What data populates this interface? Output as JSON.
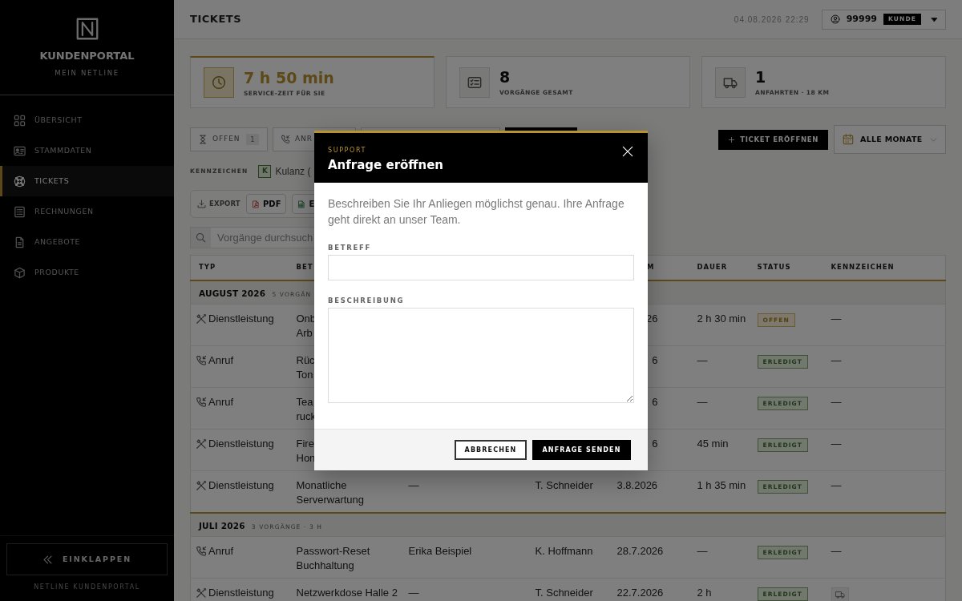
{
  "sidebar": {
    "title": "KUNDENPORTAL",
    "subtitle": "MEIN NETLINE",
    "items": [
      {
        "label": "ÜBERSICHT",
        "selected": false
      },
      {
        "label": "STAMMDATEN",
        "selected": false
      },
      {
        "label": "TICKETS",
        "selected": true
      },
      {
        "label": "RECHNUNGEN",
        "selected": false
      },
      {
        "label": "ANGEBOTE",
        "selected": false
      },
      {
        "label": "PRODUKTE",
        "selected": false
      }
    ],
    "collapse_button": "EINKLAPPEN",
    "footer": "NETLINE KUNDENPORTAL"
  },
  "header": {
    "title": "TICKETS",
    "timestamp": "04.08.2026 22:29",
    "account": {
      "number": "99999",
      "role": "KUNDE"
    }
  },
  "stats": [
    {
      "value": "7 h 50 min",
      "label": "SERVICE-ZEIT FÜR SIE",
      "highlighted": true
    },
    {
      "value": "8",
      "label": "VORGÄNGE GESAMT",
      "highlighted": false
    },
    {
      "value": "1",
      "label": "ANFAHRTEN · 18 KM",
      "highlighted": false
    }
  ],
  "filter_tabs": [
    {
      "label": "OFFEN",
      "count": "1",
      "selected": false
    },
    {
      "label": "ANR",
      "selected": false
    },
    {
      "selected": false
    },
    {
      "selected": true
    }
  ],
  "new_ticket_button": "TICKET ERÖFFNEN",
  "month_filter": "ALLE MONATE",
  "tags": {
    "label": "KENNZEICHEN",
    "items": [
      {
        "letter": "K",
        "text": "Kulanz ("
      }
    ]
  },
  "export": {
    "label": "EXPORT",
    "buttons": [
      "PDF",
      "E"
    ]
  },
  "search": {
    "placeholder": "Vorgänge durchsuch"
  },
  "table": {
    "columns": [
      {
        "label": "TYP"
      },
      {
        "label": "BET"
      },
      {},
      {},
      {
        "label": "M",
        "cut": true
      },
      {
        "label": "DAUER"
      },
      {
        "label": "STATUS"
      },
      {
        "label": "KENNZEICHEN"
      }
    ],
    "groups": [
      {
        "title": "AUGUST 2026",
        "summary": "5 VORGÄN",
        "rows": [
          {
            "kind": "service",
            "type": "Dienstleistung",
            "subject": [
              "Onb",
              "Arb"
            ],
            "date": "26",
            "date_cut": true,
            "duration": "2 h 30 min",
            "status": {
              "kind": "open",
              "text": "OFFEN"
            },
            "mark": {
              "kind": "text",
              "text": "—"
            }
          },
          {
            "kind": "call",
            "type": "Anruf",
            "subject": [
              "Rüc",
              "Ton"
            ],
            "date": "6",
            "date_cut": true,
            "duration": "—",
            "status": {
              "kind": "done",
              "text": "ERLEDIGT"
            },
            "mark": {
              "kind": "text",
              "text": "—"
            }
          },
          {
            "kind": "call",
            "type": "Anruf",
            "subject": [
              "Tea",
              "ruck"
            ],
            "date": "6",
            "date_cut": true,
            "duration": "—",
            "status": {
              "kind": "done",
              "text": "ERLEDIGT"
            },
            "mark": {
              "kind": "text",
              "text": "—"
            }
          },
          {
            "kind": "service",
            "type": "Dienstleistung",
            "subject": [
              "Fire",
              "Hon"
            ],
            "date": "6",
            "date_cut": true,
            "duration": "45 min",
            "status": {
              "kind": "done",
              "text": "ERLEDIGT"
            },
            "mark": {
              "kind": "text",
              "text": "—"
            }
          },
          {
            "kind": "service",
            "type": "Dienstleistung",
            "subject": [
              "Monatliche",
              "Serverwartung"
            ],
            "contact": "—",
            "technician": "T. Schneider",
            "date": "3.8.2026",
            "duration": "1 h 35 min",
            "status": {
              "kind": "done",
              "text": "ERLEDIGT"
            },
            "mark": {
              "kind": "text",
              "text": "—"
            }
          }
        ]
      },
      {
        "title": "JULI 2026",
        "summary": "3 VORGÄNGE · 3 H",
        "rows": [
          {
            "kind": "call",
            "type": "Anruf",
            "subject": [
              "Passwort-Reset",
              "Buchhaltung"
            ],
            "contact": "Erika Beispiel",
            "technician": "K. Hoffmann",
            "date": "28.7.2026",
            "duration": "—",
            "status": {
              "kind": "done",
              "text": "ERLEDIGT"
            },
            "mark": {
              "kind": "text",
              "text": "—"
            }
          },
          {
            "kind": "service",
            "type": "Dienstleistung",
            "subject": [
              "Netzwerkdose Halle 2"
            ],
            "contact": "—",
            "technician": "T. Schneider",
            "date": "22.7.2026",
            "duration": "2 h",
            "status": {
              "kind": "done",
              "text": "ERLEDIGT"
            },
            "mark": {
              "kind": "trip"
            }
          }
        ]
      }
    ]
  },
  "modal": {
    "eyebrow": "SUPPORT",
    "title": "Anfrage eröffnen",
    "intro": "Beschreiben Sie Ihr Anliegen möglichst genau. Ihre Anfrage geht direkt an unser Team.",
    "fields": [
      {
        "kind": "input",
        "label": "BETREFF"
      },
      {
        "kind": "textarea",
        "label": "BESCHREIBUNG"
      }
    ],
    "buttons": [
      {
        "kind": "secondary",
        "label": "ABBRECHEN"
      },
      {
        "kind": "primary",
        "label": "ANFRAGE SENDEN"
      }
    ]
  }
}
